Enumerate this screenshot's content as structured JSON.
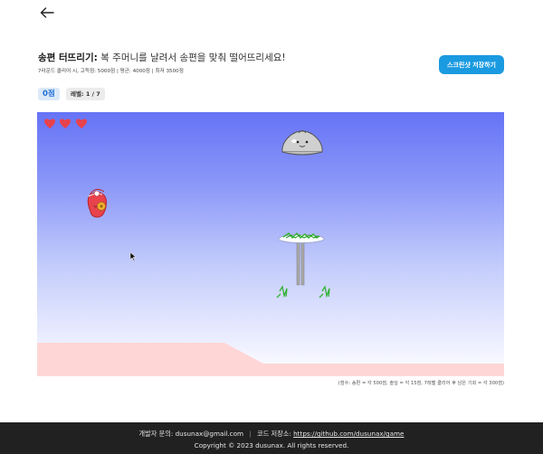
{
  "header": {
    "title_strong": "송편 터뜨리기:",
    "title_desc": "복 주머니를 날려서 송편을 맞춰 떨어뜨리세요!",
    "subtitle": "7라운드 클리어 시, 고득점: 5000점 | 평균: 4000점 | 최저 3500점",
    "screenshot_button": "스크린샷 저장하기",
    "back_icon": "arrow-left-icon"
  },
  "status": {
    "score": "0점",
    "level": "레벨: 1 / 7"
  },
  "game": {
    "lives": 3,
    "colors": {
      "heart": "#e8424c",
      "ground": "#ffd6d6",
      "sky_top": "#6673f6",
      "pouch": "#e8424c",
      "songpyeon": "#cfcfcf",
      "leaf": "#33b233"
    },
    "icons": [
      "heart-icon",
      "bok-pouch-icon",
      "songpyeon-icon",
      "cursor-icon",
      "pine-needle-plate-icon"
    ]
  },
  "score_note": "(점수: 송편 = 각 500점, 솔잎 = 각 15점, 7레벨 클리어 후 남은 기회 = 각 300점)",
  "footer": {
    "contact_label": "개발자 문의:",
    "contact_email": "dusunax@gmail.com",
    "code_label": "코드 저장소:",
    "code_link": "https://github.com/dusunax/game",
    "copyright": "Copyright © 2023 dusunax. All rights reserved."
  }
}
